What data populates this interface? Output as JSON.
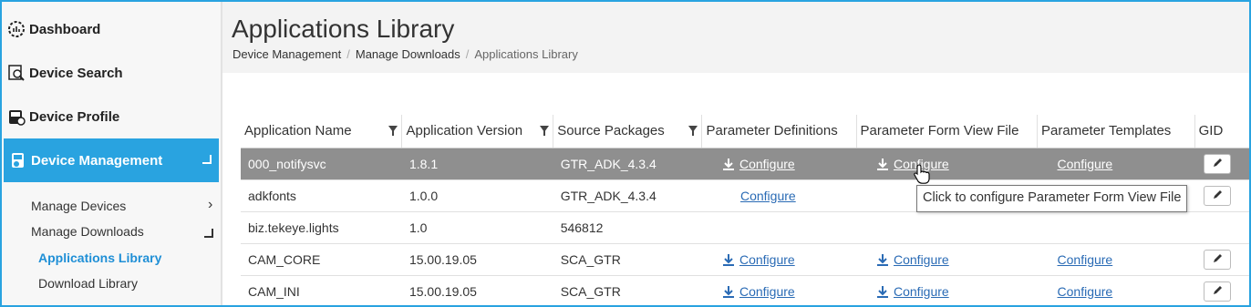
{
  "sidebar": {
    "dashboard": "Dashboard",
    "device_search": "Device Search",
    "device_profile": "Device Profile",
    "device_management": "Device Management",
    "subitems": [
      "Manage Devices",
      "Manage Downloads",
      "Applications Library",
      "Download Library"
    ]
  },
  "page": {
    "title": "Applications Library",
    "breadcrumb": [
      "Device Management",
      "Manage Downloads",
      "Applications Library"
    ]
  },
  "table": {
    "headers": [
      "Application Name",
      "Application Version",
      "Source Packages",
      "Parameter Definitions",
      "Parameter Form View File",
      "Parameter Templates",
      "GID"
    ],
    "rows": [
      {
        "name": "000_notifysvc",
        "version": "1.8.1",
        "source": "GTR_ADK_4.3.4",
        "def": "Configure",
        "form": "Configure",
        "tmpl": "Configure"
      },
      {
        "name": "adkfonts",
        "version": "1.0.0",
        "source": "GTR_ADK_4.3.4",
        "def": "Configure",
        "form": "",
        "tmpl": ""
      },
      {
        "name": "biz.tekeye.lights",
        "version": "1.0",
        "source": "546812",
        "def": "",
        "form": "",
        "tmpl": ""
      },
      {
        "name": "CAM_CORE",
        "version": "15.00.19.05",
        "source": "SCA_GTR",
        "def": "Configure",
        "form": "Configure",
        "tmpl": "Configure"
      },
      {
        "name": "CAM_INI",
        "version": "15.00.19.05",
        "source": "SCA_GTR",
        "def": "Configure",
        "form": "Configure",
        "tmpl": "Configure"
      }
    ]
  },
  "tooltip": "Click to configure Parameter Form View  File",
  "colors": {
    "accent": "#29a3e0",
    "link": "#2a6bb5",
    "selected_row": "#8f8f8f"
  },
  "icons": [
    "dashboard-icon",
    "device-search-icon",
    "device-profile-icon",
    "device-management-icon",
    "download-icon",
    "filter-icon",
    "pencil-icon",
    "hand-cursor-icon"
  ]
}
